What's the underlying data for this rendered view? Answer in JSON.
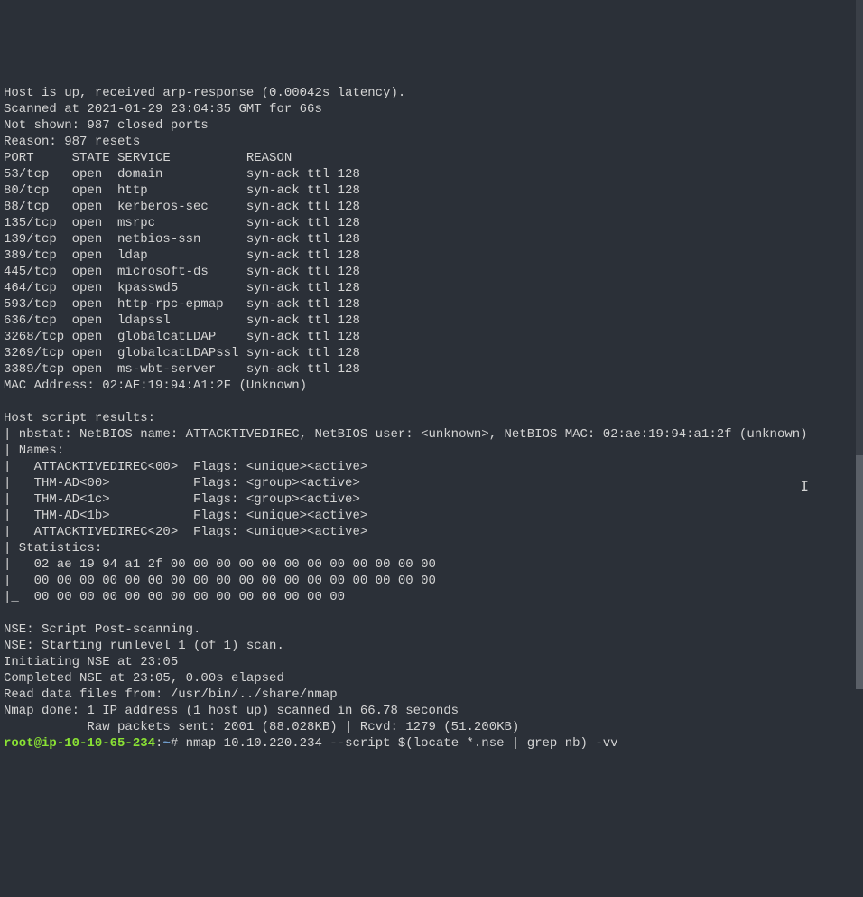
{
  "header": {
    "host_up": "Host is up, received arp-response (0.00042s latency).",
    "scanned_at": "Scanned at 2021-01-29 23:04:35 GMT for 66s",
    "not_shown": "Not shown: 987 closed ports",
    "reason": "Reason: 987 resets"
  },
  "port_header": "PORT     STATE SERVICE          REASON",
  "ports": [
    "53/tcp   open  domain           syn-ack ttl 128",
    "80/tcp   open  http             syn-ack ttl 128",
    "88/tcp   open  kerberos-sec     syn-ack ttl 128",
    "135/tcp  open  msrpc            syn-ack ttl 128",
    "139/tcp  open  netbios-ssn      syn-ack ttl 128",
    "389/tcp  open  ldap             syn-ack ttl 128",
    "445/tcp  open  microsoft-ds     syn-ack ttl 128",
    "464/tcp  open  kpasswd5         syn-ack ttl 128",
    "593/tcp  open  http-rpc-epmap   syn-ack ttl 128",
    "636/tcp  open  ldapssl          syn-ack ttl 128",
    "3268/tcp open  globalcatLDAP    syn-ack ttl 128",
    "3269/tcp open  globalcatLDAPssl syn-ack ttl 128",
    "3389/tcp open  ms-wbt-server    syn-ack ttl 128"
  ],
  "mac_address": "MAC Address: 02:AE:19:94:A1:2F (Unknown)",
  "host_script": {
    "title": "Host script results:",
    "nbstat": "| nbstat: NetBIOS name: ATTACKTIVEDIREC, NetBIOS user: <unknown>, NetBIOS MAC: 02:ae:19:94:a1:2f (unknown)",
    "names_hdr": "| Names:",
    "names": [
      "|   ATTACKTIVEDIREC<00>  Flags: <unique><active>",
      "|   THM-AD<00>           Flags: <group><active>",
      "|   THM-AD<1c>           Flags: <group><active>",
      "|   THM-AD<1b>           Flags: <unique><active>",
      "|   ATTACKTIVEDIREC<20>  Flags: <unique><active>"
    ],
    "stats_hdr": "| Statistics:",
    "stats": [
      "|   02 ae 19 94 a1 2f 00 00 00 00 00 00 00 00 00 00 00 00",
      "|   00 00 00 00 00 00 00 00 00 00 00 00 00 00 00 00 00 00",
      "|_  00 00 00 00 00 00 00 00 00 00 00 00 00 00"
    ]
  },
  "nse": {
    "post": "NSE: Script Post-scanning.",
    "start": "NSE: Starting runlevel 1 (of 1) scan.",
    "init": "Initiating NSE at 23:05",
    "complete": "Completed NSE at 23:05, 0.00s elapsed",
    "read": "Read data files from: /usr/bin/../share/nmap",
    "done": "Nmap done: 1 IP address (1 host up) scanned in 66.78 seconds",
    "raw": "           Raw packets sent: 2001 (88.028KB) | Rcvd: 1279 (51.200KB)"
  },
  "prompt": {
    "user": "root@ip-10-10-65-234",
    "sep": ":",
    "path": "~",
    "hash": "# ",
    "command": "nmap 10.10.220.234 --script $(locate *.nse | grep nb) -vv"
  }
}
